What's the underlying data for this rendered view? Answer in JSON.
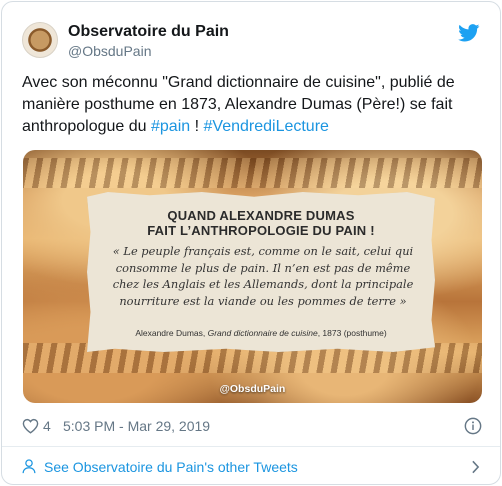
{
  "author": {
    "name": "Observatoire du Pain",
    "handle": "@ObsduPain"
  },
  "tweet": {
    "text_before": "Avec son méconnu \"Grand dictionnaire de cuisine\", publié de manière posthume en 1873, Alexandre Dumas (Père!) se fait anthropologue du ",
    "hashtag1": "#pain",
    "text_between": " ! ",
    "hashtag2": "#VendrediLecture"
  },
  "media": {
    "title_line1": "QUAND ALEXANDRE DUMAS",
    "title_line2": "FAIT L’ANTHROPOLOGIE DU PAIN !",
    "quote_line1": "« Le peuple français est, comme on le sait, celui qui",
    "quote_line2": "consomme le plus de pain. Il n’en est pas de même",
    "quote_line3": "chez les Anglais et les Allemands, dont la principale",
    "quote_line4": "nourriture est la viande ou les pommes de terre »",
    "cite_author": "Alexandre Dumas, ",
    "cite_work": "Grand dictionnaire de cuisine",
    "cite_rest": ", 1873 (posthume)",
    "watermark": "@ObsduPain"
  },
  "meta": {
    "like_count": "4",
    "timestamp": "5:03 PM - Mar 29, 2019"
  },
  "footer": {
    "more_tweets_label": "See Observatoire du Pain's other Tweets"
  },
  "icons": {
    "brand": "twitter-bird-icon",
    "like": "heart-icon",
    "info": "info-icon",
    "profile": "person-icon",
    "chevron": "chevron-right-icon"
  },
  "colors": {
    "link": "#1b95e0",
    "muted": "#657786",
    "text": "#14171a"
  }
}
